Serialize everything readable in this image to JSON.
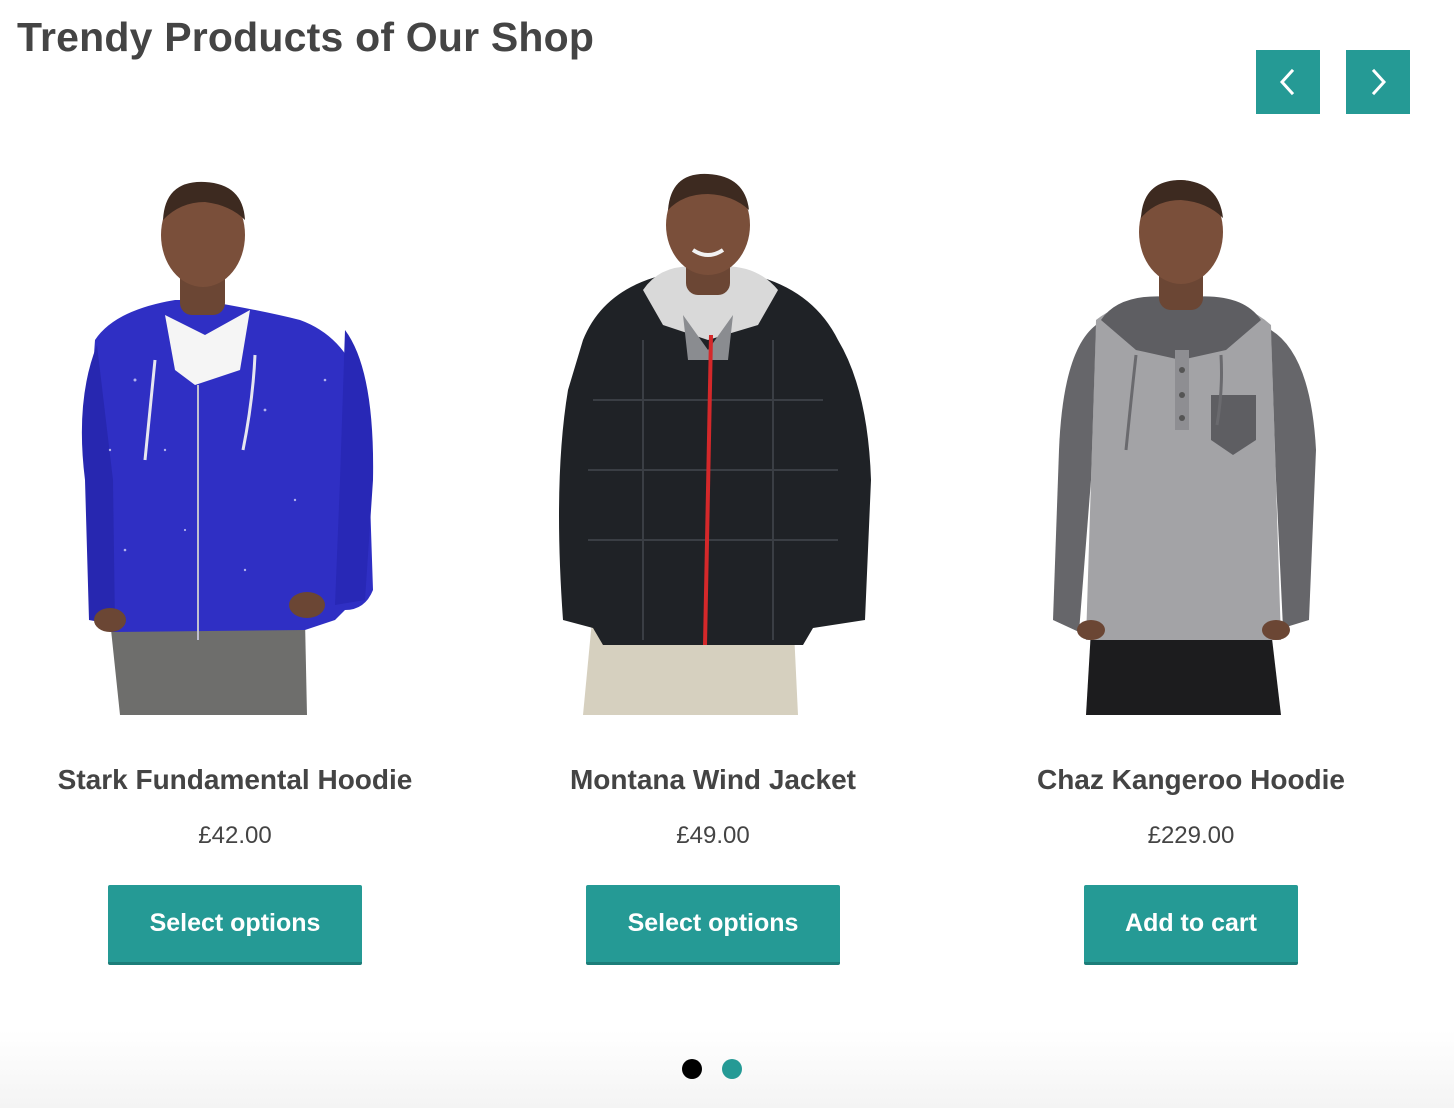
{
  "section": {
    "title": "Trendy Products of Our Shop"
  },
  "carousel": {
    "prev_icon": "chevron-left-icon",
    "next_icon": "chevron-right-icon",
    "accent_color": "#259a95",
    "pagination": {
      "pages": 2,
      "active_page": 1
    }
  },
  "products": [
    {
      "name": "Stark Fundamental Hoodie",
      "price": "£42.00",
      "button_label": "Select options",
      "image": "man-in-blue-zip-hoodie"
    },
    {
      "name": "Montana Wind Jacket",
      "price": "£49.00",
      "button_label": "Select options",
      "image": "man-in-black-quilted-jacket"
    },
    {
      "name": "Chaz Kangeroo Hoodie",
      "price": "£229.00",
      "button_label": "Add to cart",
      "image": "man-in-grey-henley-hoodie"
    }
  ]
}
